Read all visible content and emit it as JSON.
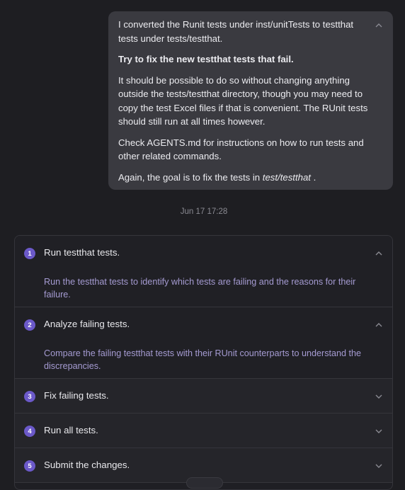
{
  "message": {
    "p1": "I converted the Runit tests under inst/unitTests to testthat tests under tests/testthat.",
    "p2": "Try to fix the new testthat tests that fail.",
    "p3": "It should be possible to do so without changing anything outside the tests/testthat directory, though you may need to copy the test Excel files if that is convenient. The RUnit tests should still run at all times however.",
    "p4": "Check AGENTS.md for instructions on how to run tests and other related commands.",
    "p5_prefix": "Again, the goal is to fix the tests in ",
    "p5_path": "test/testthat",
    "p5_suffix": " ."
  },
  "timestamp": "Jun 17 17:28",
  "plan": {
    "steps": [
      {
        "num": "1",
        "title": "Run testthat tests.",
        "desc": "Run the testthat tests to identify which tests are failing and the reasons for their failure.",
        "expanded": true
      },
      {
        "num": "2",
        "title": "Analyze failing tests.",
        "desc": "Compare the failing testthat tests with their RUnit counterparts to understand the discrepancies.",
        "expanded": true
      },
      {
        "num": "3",
        "title": "Fix failing tests.",
        "expanded": false
      },
      {
        "num": "4",
        "title": "Run all tests.",
        "expanded": false
      },
      {
        "num": "5",
        "title": "Submit the changes.",
        "expanded": false
      }
    ]
  },
  "colors": {
    "accent": "#6b59c9",
    "description": "#a59bd2",
    "background": "#1e1e22"
  }
}
